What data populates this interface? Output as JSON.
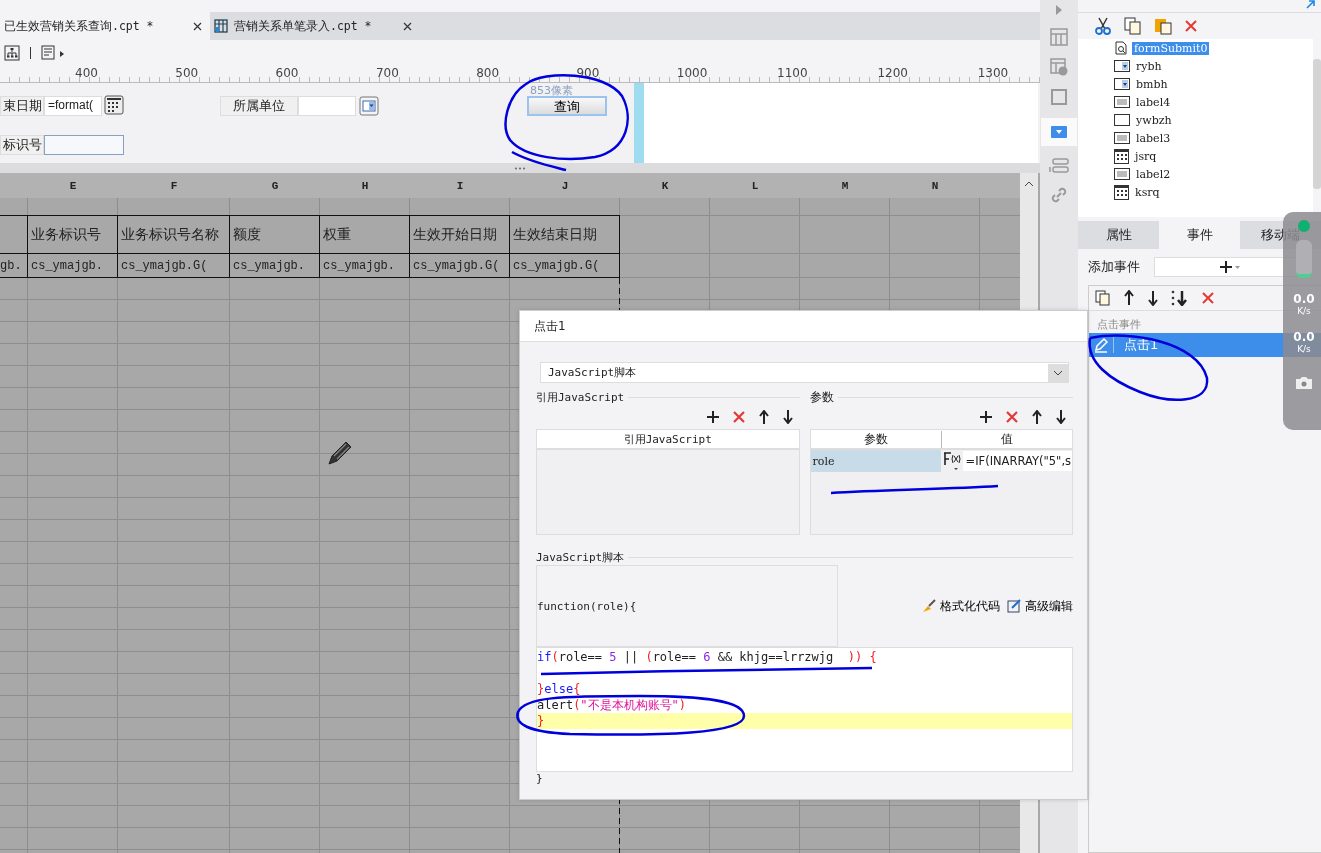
{
  "tabs": [
    {
      "label": "已生效营销关系查询.cpt *",
      "selected": true
    },
    {
      "label": "营销关系单笔录入.cpt *",
      "selected": false
    }
  ],
  "ruler": {
    "ticks": [
      "400",
      "500",
      "600",
      "700",
      "800",
      "900",
      "1000",
      "1100",
      "1200",
      "1300"
    ]
  },
  "form": {
    "end_date_label": "束日期",
    "end_date_value": "=format(",
    "unit_label": "所属单位",
    "id_label": "标识号",
    "query_button": "查询",
    "size_hint": "853像素"
  },
  "sheet": {
    "columns": [
      "",
      "E",
      "F",
      "G",
      "H",
      "I",
      "J",
      "K",
      "L",
      "M",
      "N"
    ],
    "header_row": [
      "业务标识号",
      "业务标识号名称",
      "额度",
      "权重",
      "生效开始日期",
      "生效结束日期"
    ],
    "data_row": [
      "gb.",
      "cs_ymajgb.",
      "cs_ymajgb.G(",
      "cs_ymajgb.",
      "cs_ymajgb.",
      "cs_ymajgb.G(",
      "cs_ymajgb.G("
    ]
  },
  "dialog": {
    "title": "点击1",
    "type_select": "JavaScript脚本",
    "ref_section": "引用JavaScript",
    "ref_column": "引用JavaScript",
    "params_section": "参数",
    "params_columns": [
      "参数",
      "值"
    ],
    "params": [
      {
        "name": "role",
        "value": "=IF(INARRAY(\"5\",s",
        "selected": true
      }
    ],
    "script_section": "JavaScript脚本",
    "script_head": "function(role){",
    "format_button": "格式化代码",
    "advanced_button": "高级编辑",
    "code_lines": [
      {
        "current": false,
        "tokens": [
          {
            "kind": "keyword",
            "text": "if"
          },
          {
            "kind": "punct",
            "text": "("
          },
          {
            "kind": "plain",
            "text": "role== "
          },
          {
            "kind": "number",
            "text": "5"
          },
          {
            "kind": "plain",
            "text": " || "
          },
          {
            "kind": "punct",
            "text": "("
          },
          {
            "kind": "plain",
            "text": "role== "
          },
          {
            "kind": "number",
            "text": "6"
          },
          {
            "kind": "plain",
            "text": " && khjg==lrrzwjg  "
          },
          {
            "kind": "punct",
            "text": ")) {"
          }
        ]
      },
      {
        "current": false
      },
      {
        "current": false,
        "tokens": [
          {
            "kind": "punct",
            "text": "}"
          },
          {
            "kind": "keyword",
            "text": "else"
          },
          {
            "kind": "punct",
            "text": "{"
          }
        ]
      },
      {
        "current": false,
        "tokens": [
          {
            "kind": "plain",
            "text": "alert"
          },
          {
            "kind": "punct",
            "text": "("
          },
          {
            "kind": "string",
            "text": "\"不是本机构账号\""
          },
          {
            "kind": "punct",
            "text": ")"
          }
        ]
      },
      {
        "current": true,
        "tokens": [
          {
            "kind": "punct",
            "text": "}"
          }
        ]
      }
    ],
    "script_tail": "}"
  },
  "panel": {
    "tree": [
      {
        "label": "formSubmit0",
        "kind": "submit",
        "selected": true
      },
      {
        "label": "rybh",
        "kind": "combo",
        "selected": false
      },
      {
        "label": "bmbh",
        "kind": "combo",
        "selected": false
      },
      {
        "label": "label4",
        "kind": "label",
        "selected": false
      },
      {
        "label": "ywbzh",
        "kind": "text",
        "selected": false
      },
      {
        "label": "label3",
        "kind": "label",
        "selected": false
      },
      {
        "label": "jsrq",
        "kind": "date",
        "selected": false
      },
      {
        "label": "label2",
        "kind": "label",
        "selected": false
      },
      {
        "label": "ksrq",
        "kind": "date",
        "selected": false
      }
    ],
    "tabs": [
      {
        "label": "属性",
        "selected": false
      },
      {
        "label": "事件",
        "selected": true
      },
      {
        "label": "移动端",
        "selected": false
      }
    ],
    "add_event_label": "添加事件",
    "event_group": "点击事件",
    "events": [
      {
        "label": "点击1",
        "selected": true
      }
    ]
  },
  "net_widget": {
    "up_value": "0.0",
    "up_unit": "K/s",
    "down_value": "0.0",
    "down_unit": "K/s"
  }
}
